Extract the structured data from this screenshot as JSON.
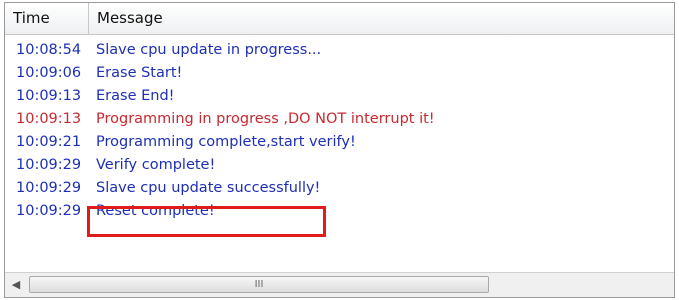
{
  "log": {
    "columns": {
      "time": "Time",
      "message": "Message"
    },
    "rows": [
      {
        "time": "10:08:54",
        "message": "Slave cpu update in progress...",
        "level": "info"
      },
      {
        "time": "10:09:06",
        "message": "Erase Start!",
        "level": "info"
      },
      {
        "time": "10:09:13",
        "message": "Erase End!",
        "level": "info"
      },
      {
        "time": "10:09:13",
        "message": "Programming in progress ,DO NOT interrupt it!",
        "level": "warn"
      },
      {
        "time": "10:09:21",
        "message": "Programming complete,start verify!",
        "level": "info"
      },
      {
        "time": "10:09:29",
        "message": "Verify complete!",
        "level": "info"
      },
      {
        "time": "10:09:29",
        "message": "Slave cpu update successfully!",
        "level": "info"
      },
      {
        "time": "10:09:29",
        "message": "Reset complete!",
        "level": "info"
      }
    ],
    "highlighted_row_index": 6,
    "colors": {
      "info": "#1d2fb6",
      "warn": "#c8282f",
      "highlight": "#e01b1b"
    }
  },
  "scrollbar": {
    "left_arrow_icon": "chevron-left-icon",
    "grip_glyph": "III"
  }
}
